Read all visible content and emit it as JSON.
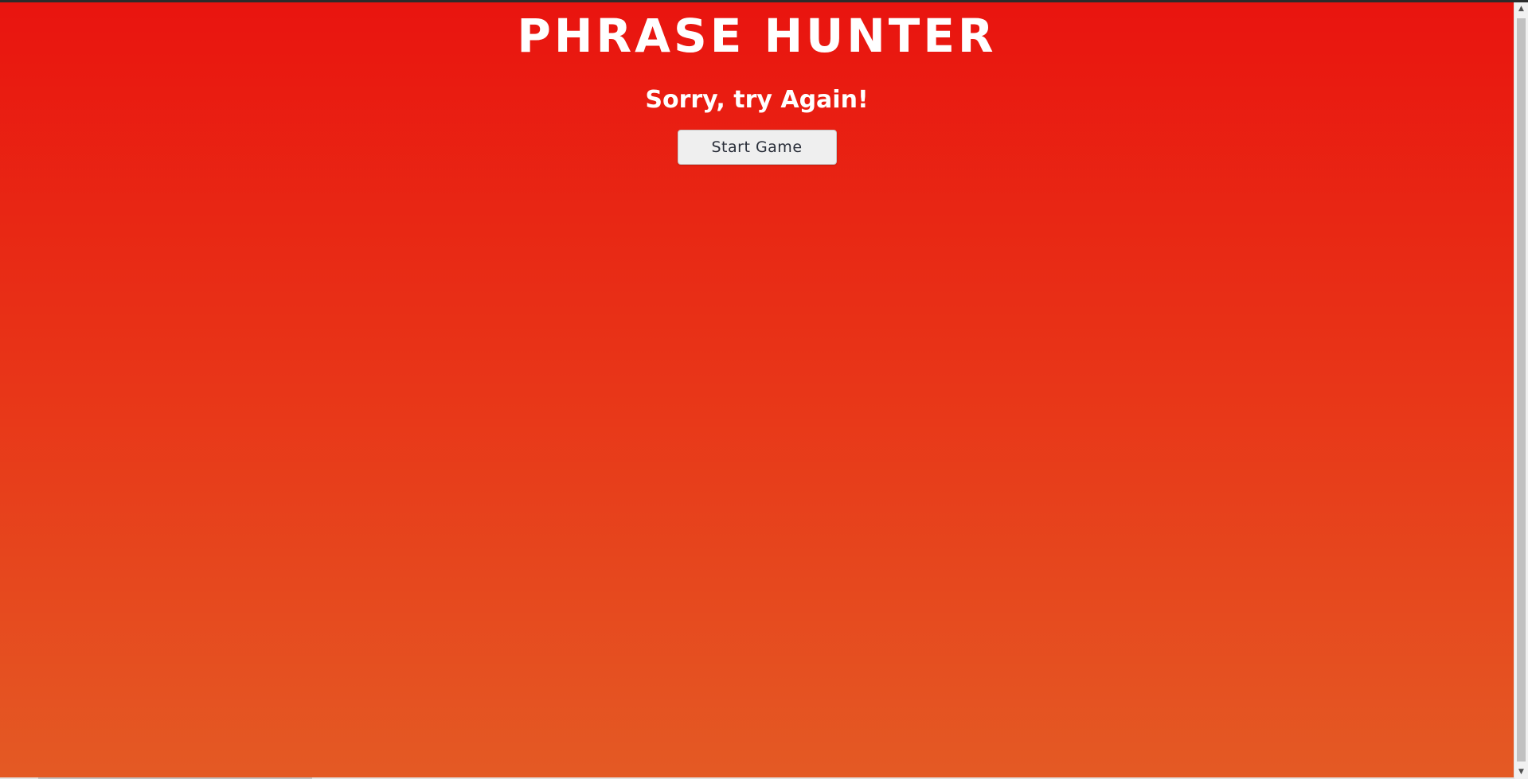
{
  "overlay": {
    "title": "PHRASE HUNTER",
    "message": "Sorry, try Again!",
    "start_button_label": "Start Game",
    "background_colors": [
      "#e9140f",
      "#e83618",
      "#e45a24"
    ]
  },
  "scrollbar": {
    "up_icon": "▲",
    "down_icon": "▼"
  }
}
